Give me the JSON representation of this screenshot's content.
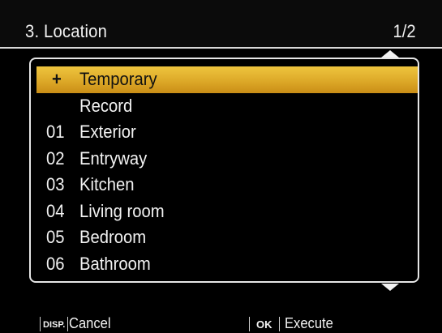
{
  "header": {
    "title": "3. Location",
    "page_indicator": "1/2"
  },
  "list": {
    "items": [
      {
        "number": "+",
        "label": "Temporary",
        "selected": true
      },
      {
        "number": "",
        "label": "Record",
        "selected": false
      },
      {
        "number": "01",
        "label": "Exterior",
        "selected": false
      },
      {
        "number": "02",
        "label": "Entryway",
        "selected": false
      },
      {
        "number": "03",
        "label": "Kitchen",
        "selected": false
      },
      {
        "number": "04",
        "label": "Living room",
        "selected": false
      },
      {
        "number": "05",
        "label": "Bedroom",
        "selected": false
      },
      {
        "number": "06",
        "label": "Bathroom",
        "selected": false
      }
    ]
  },
  "footer": {
    "disp_key": "DISP.",
    "cancel_label": "Cancel",
    "ok_key": "OK",
    "execute_label": "Execute"
  },
  "colors": {
    "selection": "#dba626",
    "background": "#000000",
    "text": "#f2f2f2"
  },
  "icons": {
    "scroll_up": "triangle-up-icon",
    "scroll_down": "triangle-down-icon"
  }
}
